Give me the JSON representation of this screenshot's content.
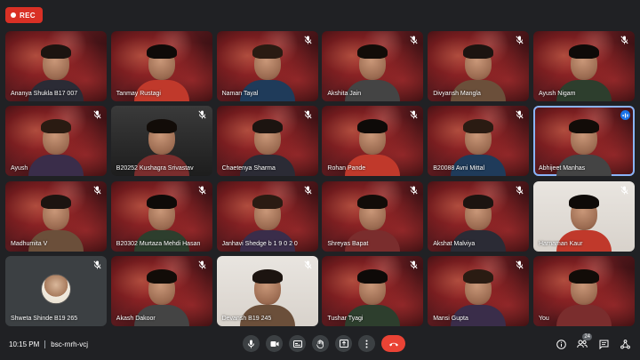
{
  "recording": {
    "label": "REC"
  },
  "participants": [
    {
      "name": "Ananya Shukla B17 007",
      "muted": false,
      "style": "space"
    },
    {
      "name": "Tanmay Rustagi",
      "muted": false,
      "style": "space"
    },
    {
      "name": "Naman Tayal",
      "muted": true,
      "style": "space"
    },
    {
      "name": "Akshita Jain",
      "muted": true,
      "style": "space"
    },
    {
      "name": "Divyansh Mangla",
      "muted": true,
      "style": "space"
    },
    {
      "name": "Ayush Nigam",
      "muted": true,
      "style": "space"
    },
    {
      "name": "Ayush",
      "muted": true,
      "style": "space"
    },
    {
      "name": "B20252 Kushagra Srivastav",
      "muted": true,
      "style": "dark"
    },
    {
      "name": "Chaetenya Sharma",
      "muted": true,
      "style": "space"
    },
    {
      "name": "Rohan Pande",
      "muted": true,
      "style": "space"
    },
    {
      "name": "B20088 Avni Mittal",
      "muted": true,
      "style": "space"
    },
    {
      "name": "Abhijeet Manhas",
      "muted": false,
      "speaking": true,
      "style": "space"
    },
    {
      "name": "Madhumita V",
      "muted": true,
      "style": "space"
    },
    {
      "name": "B20302 Murtaza Mehdi Hasan",
      "muted": true,
      "style": "space"
    },
    {
      "name": "Janhavi Shedge b 1 9 0 2 0",
      "muted": true,
      "style": "space"
    },
    {
      "name": "Shreyas Bapat",
      "muted": true,
      "style": "space"
    },
    {
      "name": "Akshat Malviya",
      "muted": true,
      "style": "space"
    },
    {
      "name": "Harnaman Kaur",
      "muted": true,
      "style": "light"
    },
    {
      "name": "Shweta Shinde B19 265",
      "muted": true,
      "style": "avatar"
    },
    {
      "name": "Akash Dakoor",
      "muted": true,
      "style": "space"
    },
    {
      "name": "Devansh B19 245",
      "muted": true,
      "style": "light"
    },
    {
      "name": "Tushar Tyagi",
      "muted": true,
      "style": "space"
    },
    {
      "name": "Mansi Gupta",
      "muted": true,
      "style": "space"
    },
    {
      "name": "You",
      "muted": false,
      "style": "space"
    }
  ],
  "footer": {
    "time": "10:15 PM",
    "meeting_code": "bsc-rnrh-vcj",
    "participant_count": "24"
  },
  "colors": {
    "accent": "#8ab4f8",
    "end_call": "#ea4335",
    "rec": "#d93025",
    "background": "#202124"
  }
}
